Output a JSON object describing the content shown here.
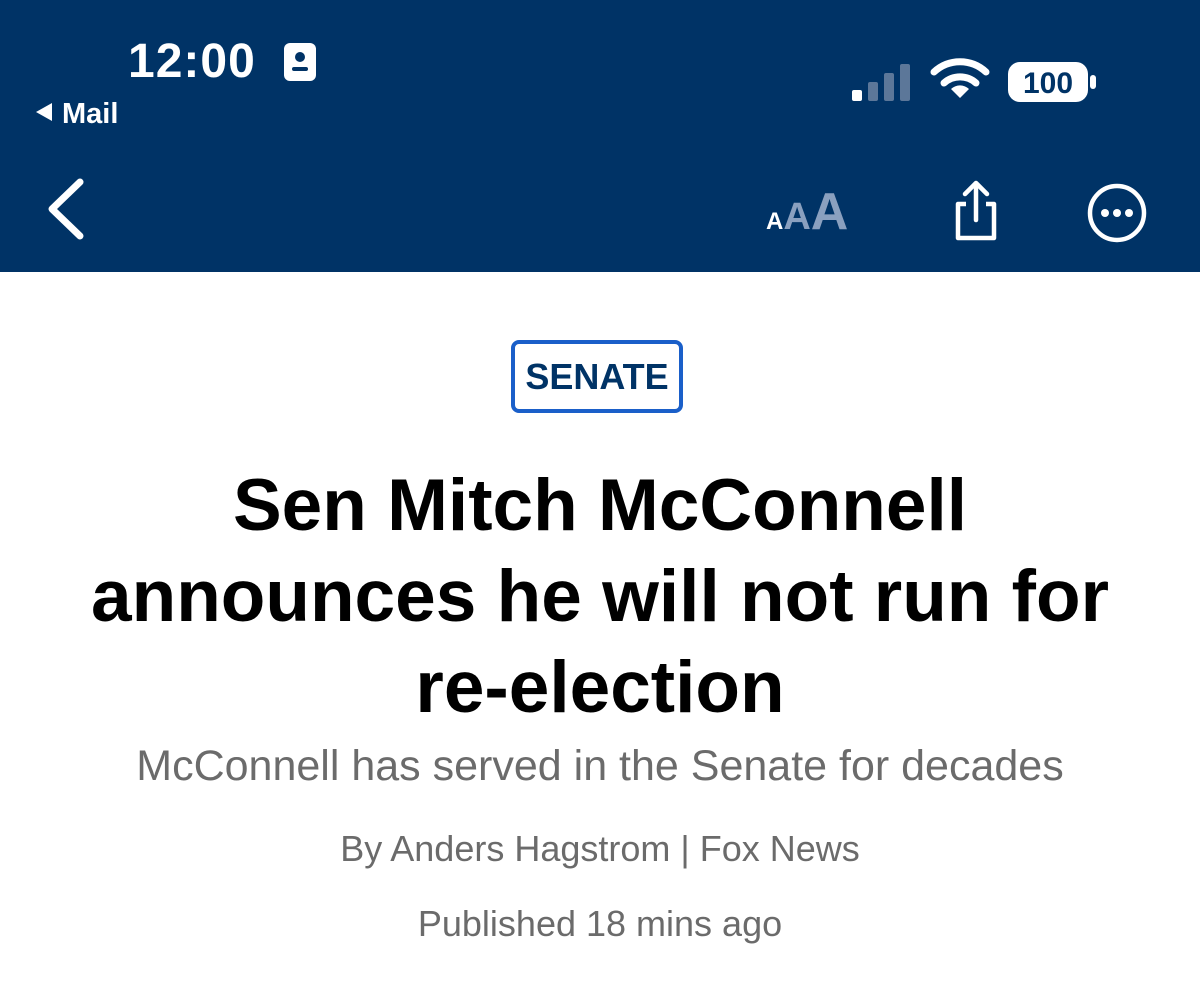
{
  "status_bar": {
    "time": "12:00",
    "back_app_label": "Mail",
    "battery_level": "100",
    "cellular_bars_active": 1,
    "cellular_bars_total": 4
  },
  "nav": {
    "back_icon": "chevron-left-icon",
    "text_size_icon": "text-size-icon",
    "text_size_glyphs": [
      "A",
      "A",
      "A"
    ],
    "share_icon": "share-icon",
    "more_icon": "more-options-icon"
  },
  "article": {
    "category": "SENATE",
    "headline_lines": [
      "Sen Mitch McConnell",
      "announces he will not run for",
      "re-election"
    ],
    "subheadline": "McConnell has served in the Senate for decades",
    "byline": "By Anders Hagstrom | Fox News",
    "published": "Published 18 mins ago"
  },
  "colors": {
    "header_bg": "#003366",
    "tag_border": "#1a5fc9",
    "tag_text": "#003366",
    "headline": "#000000",
    "secondary_text": "#6b6b6b"
  }
}
